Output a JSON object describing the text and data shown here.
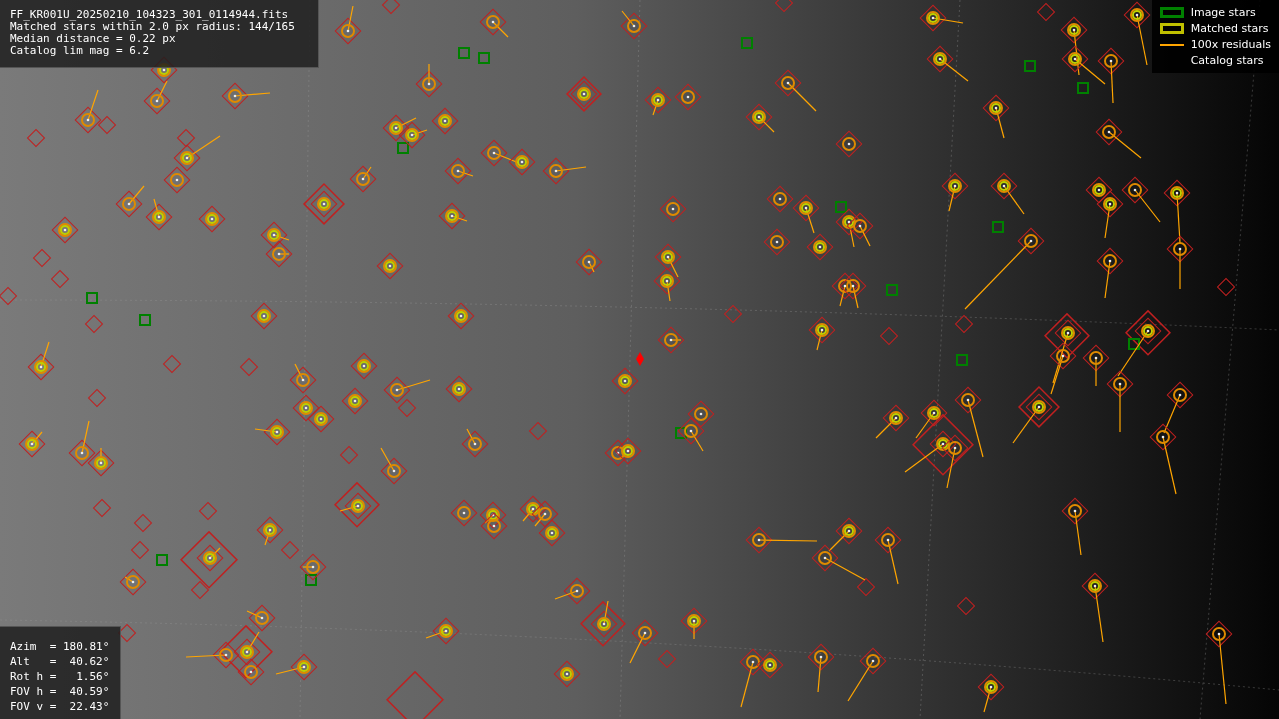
{
  "info": {
    "lines": [
      "FF_KR001U_20250210_104323_301_0114944.fits",
      "Matched stars within 2.0 px radius: 144/165",
      "Median distance = 0.22 px",
      "Catalog lim mag = 6.2"
    ]
  },
  "legend": {
    "items": [
      {
        "kind": "box",
        "label": "Image stars",
        "color": "#008000"
      },
      {
        "kind": "box",
        "label": "Matched stars",
        "color": "#bfbf00"
      },
      {
        "kind": "line",
        "label": "100x residuals",
        "color": "#ffa500"
      },
      {
        "kind": "blank",
        "label": "Catalog stars"
      }
    ]
  },
  "pointing": {
    "lines": [
      "Azim  = 180.81°",
      "Alt   =  40.62°",
      "Rot h =   1.56°",
      "FOV h =  40.59°",
      "FOV v =  22.43°"
    ]
  }
}
